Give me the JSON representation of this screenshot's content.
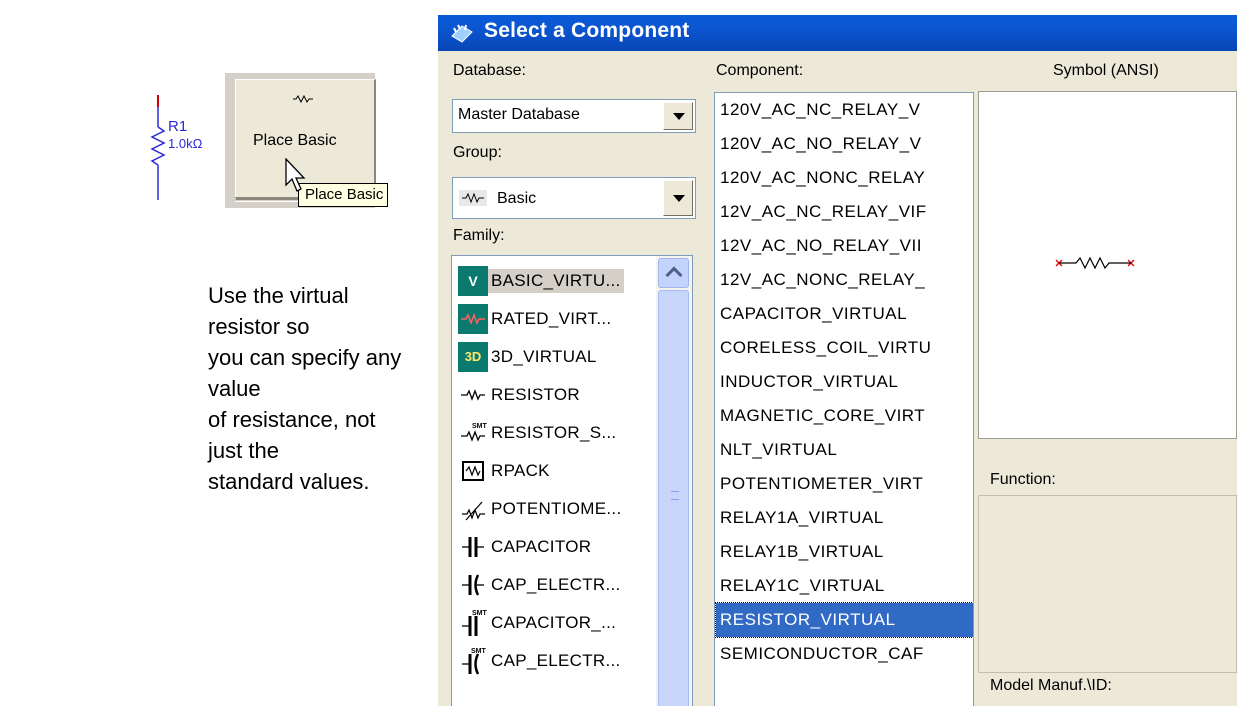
{
  "schematic": {
    "ref": "R1",
    "value": "1.0kΩ"
  },
  "toolbar": {
    "button_label": "Place Basic",
    "tooltip": "Place Basic"
  },
  "caption": "Use the virtual resistor so\n you can specify any value\nof resistance, not just the\nstandard values.",
  "dialog": {
    "title": "Select a Component",
    "database_label": "Database:",
    "database_value": "Master Database",
    "group_label": "Group:",
    "group_value": "Basic",
    "family_label": "Family:",
    "component_label": "Component:",
    "symbol_label": "Symbol (ANSI)",
    "function_label": "Function:",
    "model_label": "Model Manuf.\\ID:",
    "families": [
      {
        "label": "BASIC_VIRTU...",
        "icon": "virtual-icon"
      },
      {
        "label": "RATED_VIRT...",
        "icon": "rated-virtual-icon"
      },
      {
        "label": "3D_VIRTUAL",
        "icon": "3d-icon"
      },
      {
        "label": "RESISTOR",
        "icon": "resistor-icon"
      },
      {
        "label": "RESISTOR_S...",
        "icon": "resistor-smt-icon"
      },
      {
        "label": "RPACK",
        "icon": "rpack-icon"
      },
      {
        "label": "POTENTIOME...",
        "icon": "potentiometer-icon"
      },
      {
        "label": "CAPACITOR",
        "icon": "capacitor-icon"
      },
      {
        "label": "CAP_ELECTR...",
        "icon": "cap-electrolytic-icon"
      },
      {
        "label": "CAPACITOR_...",
        "icon": "capacitor-smt-icon"
      },
      {
        "label": "CAP_ELECTR...",
        "icon": "cap-electrolytic-smt-icon"
      }
    ],
    "components": [
      "120V_AC_NC_RELAY_V",
      "120V_AC_NO_RELAY_V",
      "120V_AC_NONC_RELAY",
      "12V_AC_NC_RELAY_VIF",
      "12V_AC_NO_RELAY_VII",
      "12V_AC_NONC_RELAY_",
      "CAPACITOR_VIRTUAL",
      "CORELESS_COIL_VIRTU",
      "INDUCTOR_VIRTUAL",
      "MAGNETIC_CORE_VIRT",
      "NLT_VIRTUAL",
      "POTENTIOMETER_VIRT",
      "RELAY1A_VIRTUAL",
      "RELAY1B_VIRTUAL",
      "RELAY1C_VIRTUAL",
      "RESISTOR_VIRTUAL",
      "SEMICONDUCTOR_CAF"
    ],
    "selected_component": "RESISTOR_VIRTUAL"
  },
  "colors": {
    "title_bar": "#0a5ad8",
    "selection": "#316ac5",
    "symbol_marker": "#e00000"
  }
}
